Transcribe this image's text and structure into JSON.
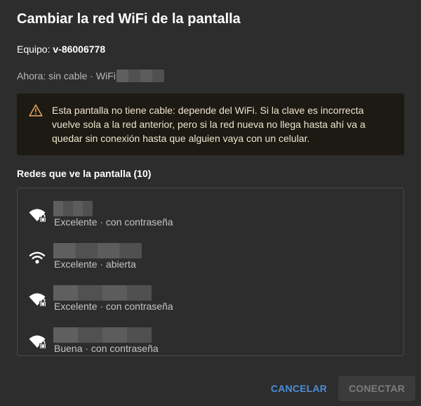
{
  "dialog": {
    "title": "Cambiar la red WiFi de la pantalla",
    "device_label": "Equipo:",
    "device_id": "v-86006778",
    "current_status": "Ahora: sin cable · WiFi"
  },
  "warning": {
    "icon": "warning-icon",
    "text": "Esta pantalla no tiene cable: depende del WiFi. Si la clave es incorrecta vuelve sola a la red anterior, pero si la red nueva no llega hasta ahí va a quedar sin conexión hasta que alguien vaya con un celular."
  },
  "networks": {
    "title": "Redes que ve la pantalla (10)",
    "items": [
      {
        "meta": "Excelente · con contraseña",
        "icon": "wifi-locked-icon"
      },
      {
        "meta": "Excelente · abierta",
        "icon": "wifi-icon"
      },
      {
        "meta": "Excelente · con contraseña",
        "icon": "wifi-locked-icon"
      },
      {
        "meta": "Buena · con contraseña",
        "icon": "wifi-locked-icon"
      }
    ]
  },
  "buttons": {
    "cancel": "CANCELAR",
    "connect": "CONECTAR"
  },
  "colors": {
    "background": "#2d2d2d",
    "warning_bg": "#1d1913",
    "warning_icon": "#e0a25a",
    "accent": "#4a8fd6"
  }
}
